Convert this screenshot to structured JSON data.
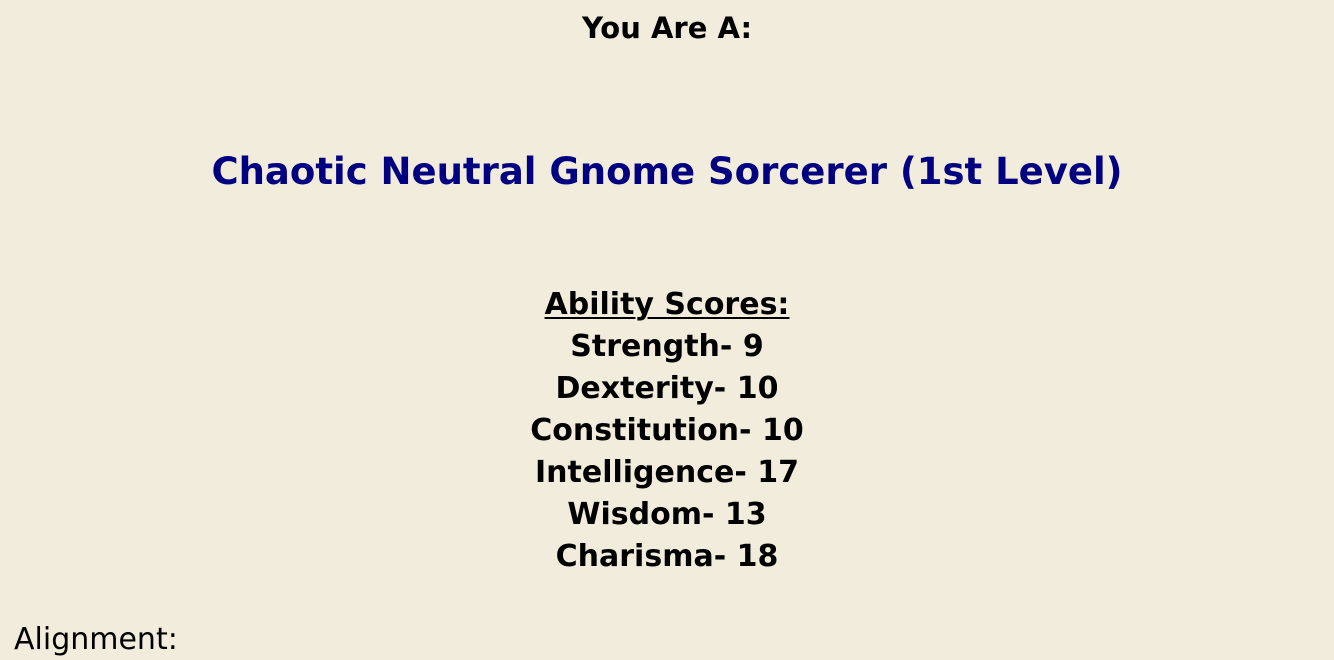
{
  "header": {
    "you_are": "You Are A:"
  },
  "result": {
    "title": "Chaotic Neutral Gnome Sorcerer (1st Level)"
  },
  "abilities": {
    "heading": "Ability Scores:",
    "items": [
      {
        "name": "Strength",
        "value": "9"
      },
      {
        "name": "Dexterity",
        "value": "10"
      },
      {
        "name": "Constitution",
        "value": "10"
      },
      {
        "name": "Intelligence",
        "value": "17"
      },
      {
        "name": "Wisdom",
        "value": "13"
      },
      {
        "name": "Charisma",
        "value": "18"
      }
    ]
  },
  "alignment": {
    "label": "Alignment:"
  },
  "colors": {
    "background": "#F2ECDC",
    "title": "#000080",
    "text": "#000000"
  }
}
